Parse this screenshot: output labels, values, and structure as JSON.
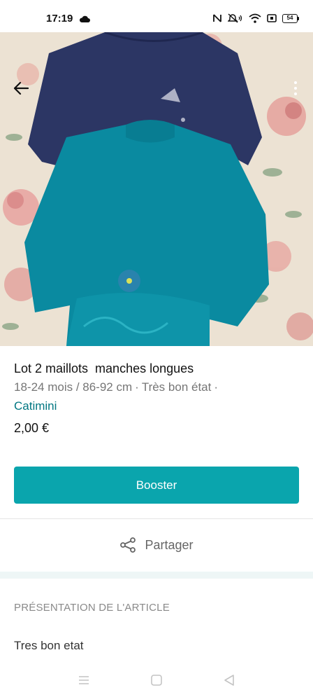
{
  "status_bar": {
    "time": "17:19",
    "battery_level": "54",
    "icons": [
      "cloud-icon",
      "nfc-icon",
      "mute-icon",
      "wifi-icon",
      "sim-icon",
      "battery-icon"
    ]
  },
  "photo": {
    "icons": {
      "back": "arrow-left-icon",
      "more": "more-vertical-icon"
    }
  },
  "item": {
    "title": "Lot 2 maillots  manches longues",
    "size": "18-24 mois / 86-92 cm",
    "separator": "·",
    "condition": "Très bon état",
    "brand": "Catimini",
    "price": "2,00 €"
  },
  "actions": {
    "boost_label": "Booster",
    "share_label": "Partager",
    "share_icon": "share-icon"
  },
  "section": {
    "heading": "PRÉSENTATION DE L'ARTICLE",
    "description": "Tres bon etat"
  },
  "nav": {
    "icons": [
      "menu-icon",
      "home-square-icon",
      "back-triangle-icon"
    ]
  },
  "colors": {
    "accent": "#0aa5ad",
    "brand_link": "#007782",
    "muted_text": "#767676",
    "section_band": "#eef6f6"
  }
}
